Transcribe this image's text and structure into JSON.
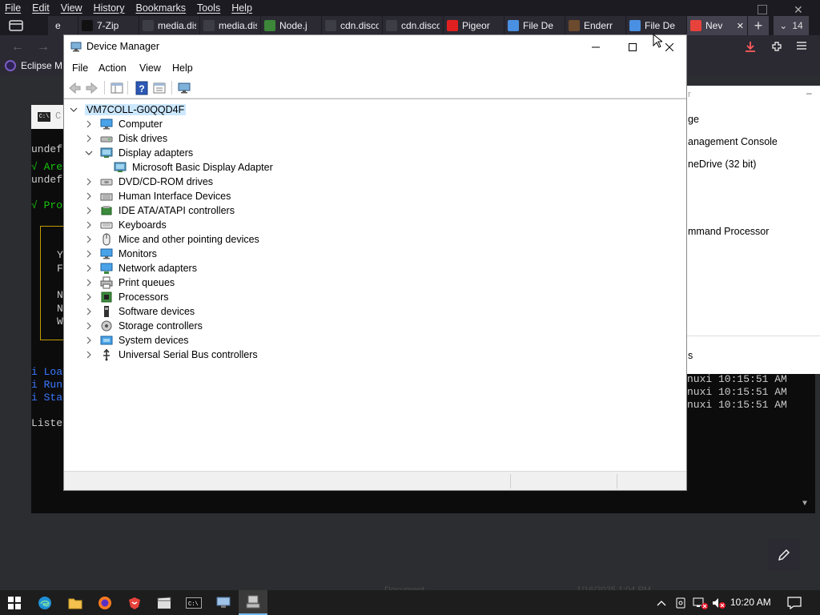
{
  "firefox": {
    "menu": [
      "File",
      "Edit",
      "View",
      "History",
      "Bookmarks",
      "Tools",
      "Help"
    ],
    "tabs": [
      {
        "label": "e",
        "favicon_color": "#3d3d45"
      },
      {
        "label": "7-Zip",
        "favicon_color": "#111111"
      },
      {
        "label": "media.disc",
        "favicon_color": "#3d3d45"
      },
      {
        "label": "media.disc",
        "favicon_color": "#3d3d45"
      },
      {
        "label": "Node.j",
        "favicon_color": "#3c873a"
      },
      {
        "label": "cdn.discor",
        "favicon_color": "#3d3d45"
      },
      {
        "label": "cdn.discor",
        "favicon_color": "#3d3d45"
      },
      {
        "label": "Pigeor",
        "favicon_color": "#e02020"
      },
      {
        "label": "File De",
        "favicon_color": "#4a90e2"
      },
      {
        "label": "Enderr",
        "favicon_color": "#6b4a2e"
      },
      {
        "label": "File De",
        "favicon_color": "#4a90e2"
      },
      {
        "label": "Nev",
        "favicon_color": "#e8423c"
      }
    ],
    "tab_count": "14",
    "bookmark": "Eclipse M"
  },
  "terminal": {
    "lines": [
      {
        "text": "undef",
        "cls": ""
      },
      {
        "text": "√ Are",
        "cls": "g"
      },
      {
        "text": "undef",
        "cls": ""
      },
      {
        "text": "√ Pro",
        "cls": "g"
      },
      {
        "text": "Y",
        "cls": ""
      },
      {
        "text": "F",
        "cls": ""
      },
      {
        "text": "N",
        "cls": ""
      },
      {
        "text": "N",
        "cls": ""
      },
      {
        "text": "W",
        "cls": ""
      },
      {
        "text": "i Loa",
        "cls": "c"
      },
      {
        "text": "i Run",
        "cls": "c"
      },
      {
        "text": "i Sta",
        "cls": "c"
      },
      {
        "text": "Liste",
        "cls": ""
      }
    ],
    "right_lines": [
      "nuxi 10:15:51 AM",
      "nuxi 10:15:51 AM",
      "nuxi 10:15:51 AM"
    ]
  },
  "mmc": {
    "items": [
      "ge",
      "anagement Console",
      "neDrive (32 bit)",
      "mmand Processor"
    ],
    "footer": "s"
  },
  "device_manager": {
    "title": "Device Manager",
    "menu": [
      "File",
      "Action",
      "View",
      "Help"
    ],
    "root": "VM7COLL-G0QQD4F",
    "nodes": [
      {
        "label": "Computer",
        "icon": "computer-icon",
        "expanded": false
      },
      {
        "label": "Disk drives",
        "icon": "disk-drive-icon",
        "expanded": false
      },
      {
        "label": "Display adapters",
        "icon": "display-adapter-icon",
        "expanded": true,
        "children": [
          {
            "label": "Microsoft Basic Display Adapter",
            "icon": "display-adapter-icon"
          }
        ]
      },
      {
        "label": "DVD/CD-ROM drives",
        "icon": "dvd-drive-icon",
        "expanded": false
      },
      {
        "label": "Human Interface Devices",
        "icon": "hid-icon",
        "expanded": false
      },
      {
        "label": "IDE ATA/ATAPI controllers",
        "icon": "ide-controller-icon",
        "expanded": false
      },
      {
        "label": "Keyboards",
        "icon": "keyboard-icon",
        "expanded": false
      },
      {
        "label": "Mice and other pointing devices",
        "icon": "mouse-icon",
        "expanded": false
      },
      {
        "label": "Monitors",
        "icon": "monitor-icon",
        "expanded": false
      },
      {
        "label": "Network adapters",
        "icon": "network-adapter-icon",
        "expanded": false
      },
      {
        "label": "Print queues",
        "icon": "printer-icon",
        "expanded": false
      },
      {
        "label": "Processors",
        "icon": "processor-icon",
        "expanded": false
      },
      {
        "label": "Software devices",
        "icon": "software-device-icon",
        "expanded": false
      },
      {
        "label": "Storage controllers",
        "icon": "storage-controller-icon",
        "expanded": false
      },
      {
        "label": "System devices",
        "icon": "system-device-icon",
        "expanded": false
      },
      {
        "label": "Universal Serial Bus controllers",
        "icon": "usb-icon",
        "expanded": false
      }
    ]
  },
  "desktop": {
    "ghost_lines": [
      "Document",
      "eslint.config.mjs",
      "1/16/2025 1:04 PM"
    ]
  },
  "taskbar": {
    "time": "10:20 AM"
  },
  "colors": {
    "selection": "#cce8ff",
    "ff_chrome": "#1c1b22",
    "terminal_green": "#16c60c",
    "terminal_blue": "#3b78ff"
  }
}
